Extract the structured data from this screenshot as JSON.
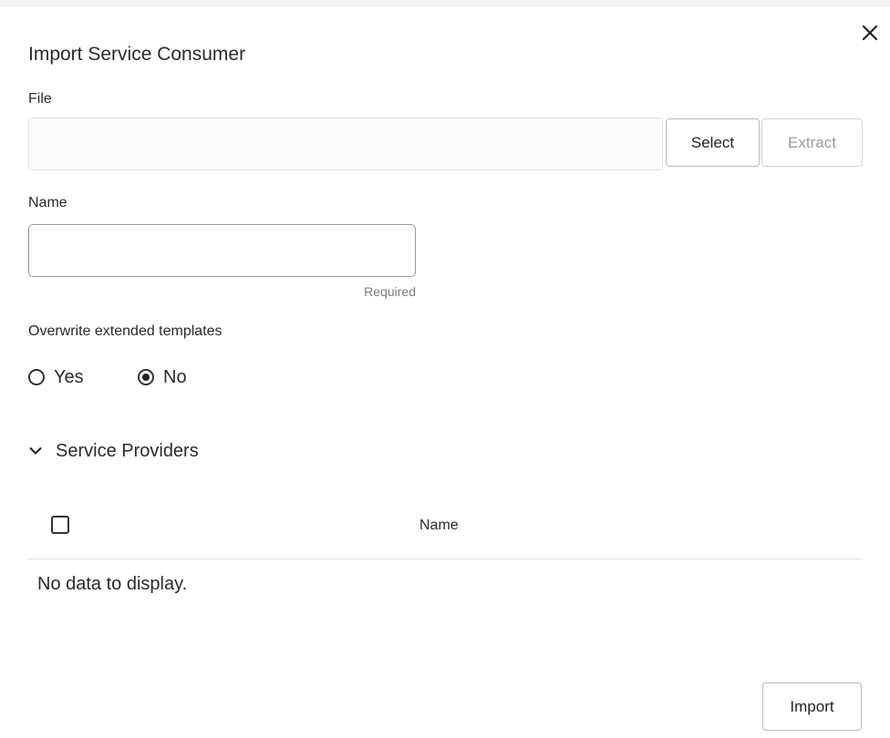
{
  "dialog": {
    "title": "Import Service Consumer",
    "close_icon": "close-icon"
  },
  "file": {
    "label": "File",
    "value": "",
    "select_label": "Select",
    "extract_label": "Extract"
  },
  "name": {
    "label": "Name",
    "value": "",
    "hint": "Required"
  },
  "overwrite": {
    "label": "Overwrite extended templates",
    "options": [
      {
        "label": "Yes",
        "selected": false
      },
      {
        "label": "No",
        "selected": true
      }
    ]
  },
  "service_providers": {
    "title": "Service Providers",
    "expanded": true,
    "chevron_icon": "chevron-down-icon",
    "columns": [
      "Name"
    ],
    "select_all_checked": false,
    "empty_message": "No data to display."
  },
  "footer": {
    "import_label": "Import"
  },
  "colors": {
    "text": "#2a2a2a",
    "border": "#b9b9b9",
    "disabled_text": "#9a9a9a",
    "hint": "#7a7a7a"
  }
}
